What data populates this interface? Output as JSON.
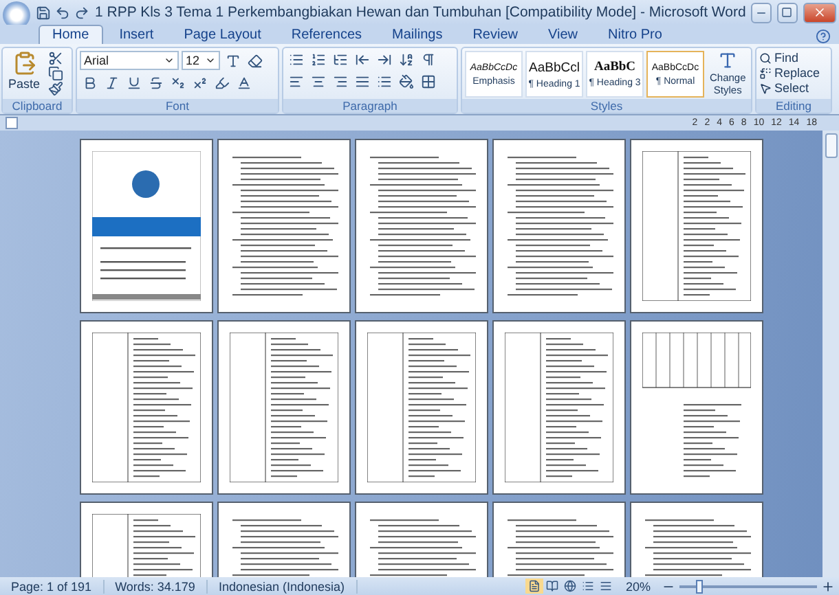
{
  "window": {
    "title": "1 RPP Kls 3 Tema 1 Perkembangbiakan Hewan dan Tumbuhan [Compatibility Mode] - Microsoft Word"
  },
  "tabs": [
    {
      "label": "Home",
      "selected": true
    },
    {
      "label": "Insert",
      "selected": false
    },
    {
      "label": "Page Layout",
      "selected": false
    },
    {
      "label": "References",
      "selected": false
    },
    {
      "label": "Mailings",
      "selected": false
    },
    {
      "label": "Review",
      "selected": false
    },
    {
      "label": "View",
      "selected": false
    },
    {
      "label": "Nitro Pro",
      "selected": false
    }
  ],
  "clipboard": {
    "paste": "Paste",
    "label": "Clipboard"
  },
  "font": {
    "name": "Arial",
    "size": "12",
    "label": "Font"
  },
  "paragraph": {
    "label": "Paragraph"
  },
  "styles": {
    "label": "Styles",
    "items": [
      {
        "preview": "AaBbCcDc",
        "name": "Emphasis",
        "kind": "italic",
        "selected": false
      },
      {
        "preview": "AaBbCcl",
        "name": "¶ Heading 1",
        "kind": "heading1",
        "selected": false
      },
      {
        "preview": "AaBbC",
        "name": "¶ Heading 3",
        "kind": "heading3",
        "selected": false
      },
      {
        "preview": "AaBbCcDc",
        "name": "¶ Normal",
        "kind": "normal",
        "selected": true
      }
    ],
    "change": "Change Styles"
  },
  "editing": {
    "find": "Find",
    "replace": "Replace",
    "select": "Select",
    "label": "Editing"
  },
  "ruler": [
    "2",
    "2",
    "4",
    "6",
    "8",
    "10",
    "12",
    "14",
    "18"
  ],
  "pages": [
    {
      "kind": "cover"
    },
    {
      "kind": "text"
    },
    {
      "kind": "text"
    },
    {
      "kind": "text"
    },
    {
      "kind": "table"
    },
    {
      "kind": "table"
    },
    {
      "kind": "table"
    },
    {
      "kind": "table"
    },
    {
      "kind": "table"
    },
    {
      "kind": "grid"
    },
    {
      "kind": "table"
    },
    {
      "kind": "text"
    },
    {
      "kind": "text"
    },
    {
      "kind": "text"
    },
    {
      "kind": "text"
    }
  ],
  "status_bar": {
    "page": "Page: 1 of 191",
    "words": "Words: 34.179",
    "language": "Indonesian (Indonesia)",
    "views": [
      {
        "selected": true
      },
      {
        "selected": false
      },
      {
        "selected": false
      },
      {
        "selected": false
      },
      {
        "selected": false
      }
    ],
    "zoom": "20%",
    "zoom_slider": {
      "level": 0.12
    }
  }
}
